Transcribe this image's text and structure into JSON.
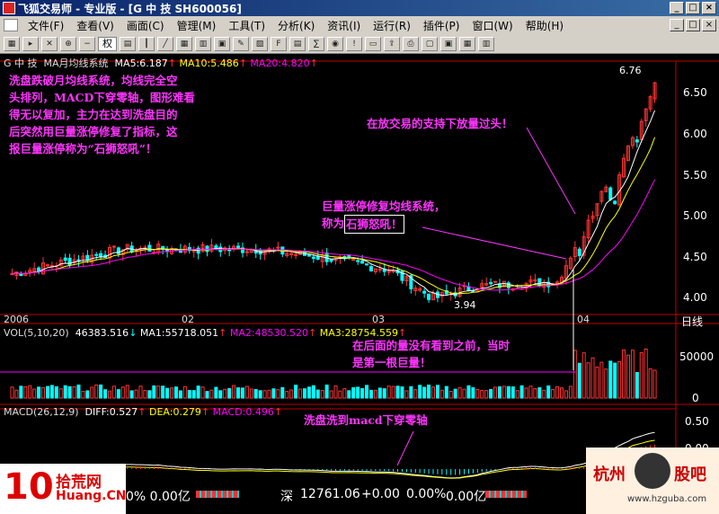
{
  "titlebar": {
    "title": "飞狐交易师 - 专业版 - [G 中  技 SH600056]",
    "btn_min": "_",
    "btn_max": "□",
    "btn_close": "×"
  },
  "menu": [
    "文件(F)",
    "查看(V)",
    "画面(C)",
    "管理(M)",
    "工具(T)",
    "分析(K)",
    "资讯(I)",
    "运行(R)",
    "插件(P)",
    "窗口(W)",
    "帮助(H)"
  ],
  "toolbar": {
    "right_select": "权"
  },
  "chart_header": {
    "name": "G 中  技",
    "indicator": "MA月均线系统",
    "ma5": "MA5:6.187",
    "ma5_arrow": "↑",
    "ma10": "MA10:5.486",
    "ma10_arrow": "↑",
    "ma20": "MA20:4.820",
    "ma20_arrow": "↑"
  },
  "vol_header": {
    "params": "VOL(5,10,20)",
    "vol": "46383.516",
    "vol_arrow": "↓",
    "ma1": "MA1:55718.051",
    "ma1_arrow": "↑",
    "ma2": "MA2:48530.520",
    "ma2_arrow": "↑",
    "ma3": "MA3:28754.559",
    "ma3_arrow": "↑"
  },
  "macd_header": {
    "params": "MACD(26,12,9)",
    "diff": "DIFF:0.527",
    "diff_arrow": "↑",
    "dea": "DEA:0.279",
    "dea_arrow": "↑",
    "macd": "MACD:0.496",
    "macd_arrow": "↑"
  },
  "date_axis": {
    "labels": [
      "2006",
      "02",
      "03",
      "04"
    ],
    "period": "日线"
  },
  "price_axis": [
    "6.50",
    "6.00",
    "5.50",
    "5.00",
    "4.50",
    "4.00"
  ],
  "vol_axis": [
    "50000",
    "0"
  ],
  "macd_axis": [
    "0.50",
    "0.00"
  ],
  "price_marks": {
    "high": "6.76",
    "low": "3.94"
  },
  "annotations": {
    "top_left": [
      "洗盘跌破月均线系统，均线完全空",
      "头排列，MACD下穿零轴，图形难看",
      "得无以复加，主力在达到洗盘目的",
      "后突然用巨量涨停修复了指标，这",
      "报巨量涨停称为“石狮怒吼”！"
    ],
    "top_right": "在放交易的支持下放量过头！",
    "mid_1": "巨量涨停修复均线系统，",
    "mid_2": "称为",
    "mid_boxed": "石狮怒吼！",
    "vol_1": "在后面的量没有看到之前，当时",
    "vol_2": "是第一根巨量！",
    "macd": "洗盘洗到macd下穿零轴"
  },
  "status": {
    "left": "0% 0.00亿",
    "index_name": "深",
    "index_value": "12761.06",
    "index_change": "+0.00",
    "index_pct": "0.00%",
    "index_amount": "0.00亿"
  },
  "logo": {
    "number": "10",
    "brand": "拾荒网",
    "url": "Huang.CN"
  },
  "watermark": {
    "left": "杭州",
    "right": "股吧",
    "url": "www.hzguba.com"
  },
  "colors": {
    "up": "#ff3333",
    "down": "#00ffff",
    "ma5": "#ffffff",
    "ma10": "#ffff00",
    "ma20": "#ff00ff",
    "annotation": "#ff33ff",
    "axis": "#c00000"
  },
  "chart_data": {
    "type": "candlestick",
    "close_points": [
      {
        "x": "2006",
        "y": 4.35
      },
      {
        "x": "02",
        "y": 4.6
      },
      {
        "x": "03",
        "y": 4.3
      },
      {
        "x": "03-low",
        "y": 3.94
      },
      {
        "x": "04",
        "y": 4.5
      },
      {
        "x": "04-high",
        "y": 6.76
      }
    ],
    "ylim": [
      3.8,
      6.9
    ]
  }
}
